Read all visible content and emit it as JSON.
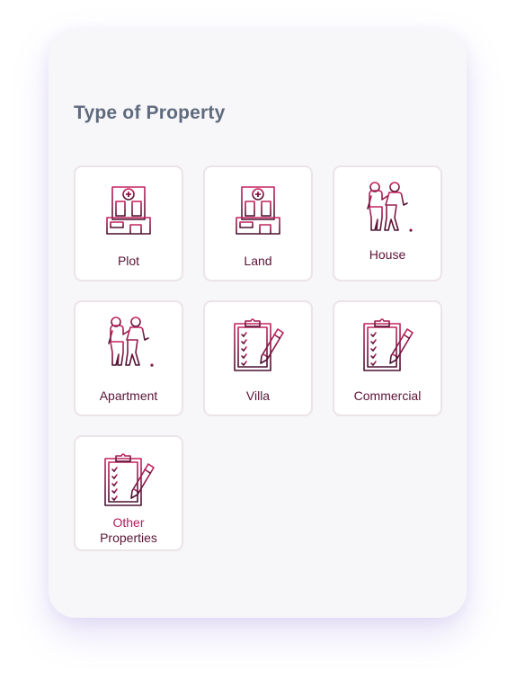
{
  "title": "Type of Property",
  "colors": {
    "primary": "#5a1435",
    "accent": "#b01e58",
    "title": "#5f6b7d"
  },
  "tiles": [
    {
      "label": "Plot",
      "icon": "building-icon"
    },
    {
      "label": "Land",
      "icon": "building-icon"
    },
    {
      "label": "House",
      "icon": "people-walking-icon"
    },
    {
      "label": "Apartment",
      "icon": "people-walking-icon"
    },
    {
      "label": "Villa",
      "icon": "clipboard-checklist-icon"
    },
    {
      "label": "Commercial",
      "icon": "clipboard-checklist-icon"
    },
    {
      "label_line1": "Other",
      "label_line2": "Properties",
      "icon": "clipboard-checklist-icon"
    }
  ]
}
